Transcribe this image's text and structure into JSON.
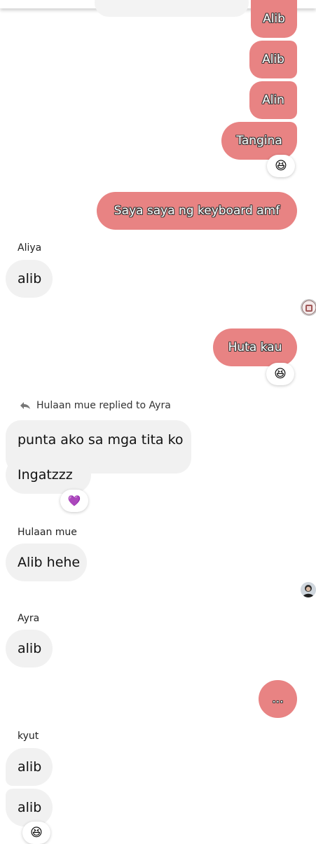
{
  "messages": {
    "out_1": "Alib",
    "out_2": "Alib",
    "out_3": "Alin",
    "out_4": "Tangina",
    "out_5": "Saya saya ng keyboard amf",
    "aliya_sender": "Aliya",
    "aliya_msg": "alib",
    "out_6": "Huta kau",
    "reply_label": "Hulaan mue replied to Ayra",
    "reply_quoted": "punta ako sa mga tita ko",
    "reply_msg": "Ingatzzz",
    "hulaan_sender": "Hulaan mue",
    "hulaan_msg": "Alib hehe",
    "ayra_sender": "Ayra",
    "ayra_msg": "alib",
    "out_7": "...",
    "kyut_sender": "kyut",
    "kyut_msg_1": "alib",
    "kyut_msg_2": "alib"
  },
  "reactions": {
    "laugh_emoji": "😆",
    "heart_emoji": "💜"
  },
  "colors": {
    "outgoing_bubble": "#e88383",
    "incoming_bubble": "#f1f1f1",
    "background": "#ffffff"
  }
}
